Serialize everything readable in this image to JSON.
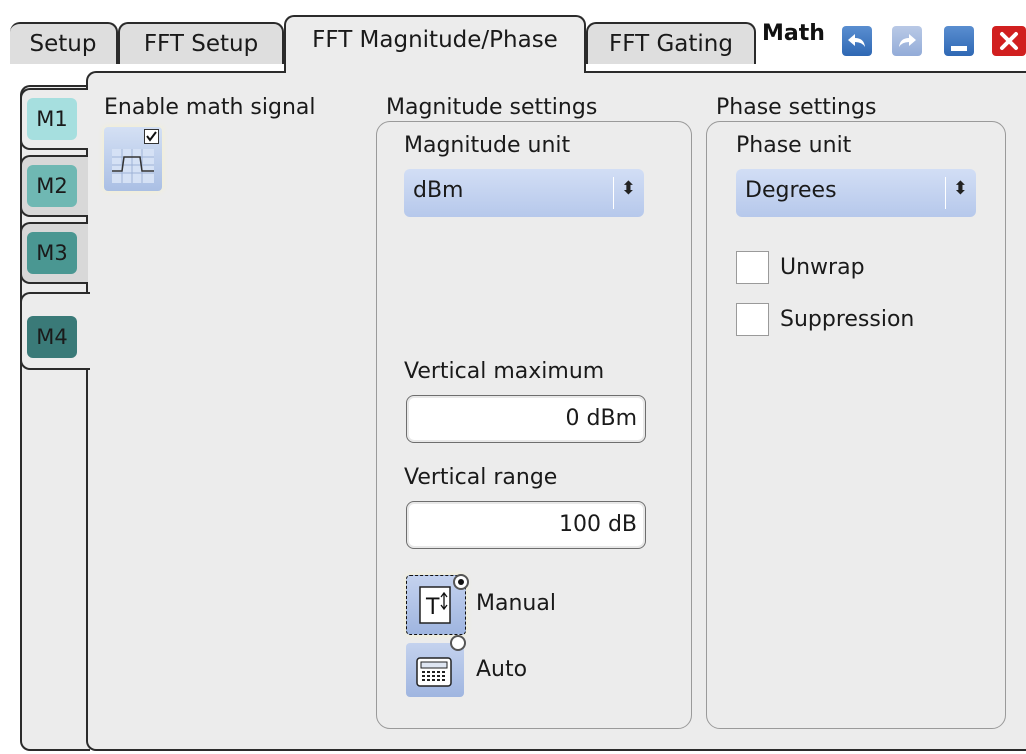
{
  "tabs": [
    {
      "label": "Setup"
    },
    {
      "label": "FFT Setup"
    },
    {
      "label": "FFT Magnitude/Phase",
      "active": true
    },
    {
      "label": "FFT Gating"
    }
  ],
  "window": {
    "title": "Math",
    "buttons": [
      "undo-icon",
      "redo-icon",
      "minimize-icon",
      "close-icon"
    ]
  },
  "math_tabs": [
    {
      "label": "M1",
      "color": "#a6dfdf"
    },
    {
      "label": "M2",
      "color": "#6fb8b3"
    },
    {
      "label": "M3",
      "color": "#4a9792"
    },
    {
      "label": "M4",
      "color": "#3a7a78",
      "active": true
    }
  ],
  "enable": {
    "label": "Enable math signal",
    "checked": true
  },
  "magnitude": {
    "title": "Magnitude settings",
    "unit_label": "Magnitude unit",
    "unit_value": "dBm",
    "vmax_label": "Vertical maximum",
    "vmax_value": "0 dBm",
    "vrange_label": "Vertical range",
    "vrange_value": "100 dB",
    "mode_manual": "Manual",
    "mode_auto": "Auto",
    "mode_selected": "Manual"
  },
  "phase": {
    "title": "Phase settings",
    "unit_label": "Phase unit",
    "unit_value": "Degrees",
    "unwrap_label": "Unwrap",
    "unwrap_checked": false,
    "suppression_label": "Suppression",
    "suppression_checked": false
  }
}
